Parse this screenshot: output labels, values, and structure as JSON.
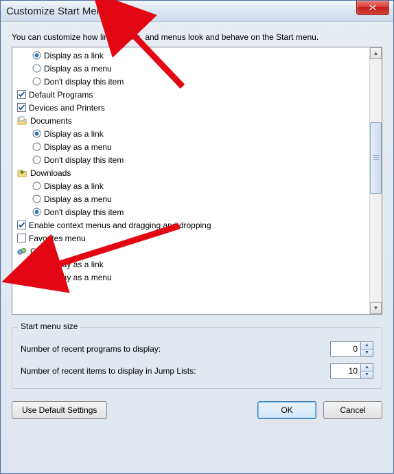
{
  "window": {
    "title": "Customize Start Menu"
  },
  "intro": "You can customize how links, icons, and menus look and behave on the Start menu.",
  "tree": {
    "group0": {
      "opt1": "Display as a link",
      "opt2": "Display as a menu",
      "opt3": "Don't display this item"
    },
    "default_programs": "Default Programs",
    "devices_printers": "Devices and Printers",
    "documents": {
      "label": "Documents",
      "opt1": "Display as a link",
      "opt2": "Display as a menu",
      "opt3": "Don't display this item"
    },
    "downloads": {
      "label": "Downloads",
      "opt1": "Display as a link",
      "opt2": "Display as a menu",
      "opt3": "Don't display this item"
    },
    "enable_context": "Enable context menus and dragging and dropping",
    "favorites": "Favorites menu",
    "games": {
      "label": "Games",
      "opt1": "Display as a link",
      "opt2": "Display as a menu"
    }
  },
  "groupbox": {
    "title": "Start menu size",
    "recent_programs_label": "Number of recent programs to display:",
    "recent_programs_value": "0",
    "recent_items_label": "Number of recent items to display in Jump Lists:",
    "recent_items_value": "10"
  },
  "buttons": {
    "defaults": "Use Default Settings",
    "ok": "OK",
    "cancel": "Cancel"
  }
}
